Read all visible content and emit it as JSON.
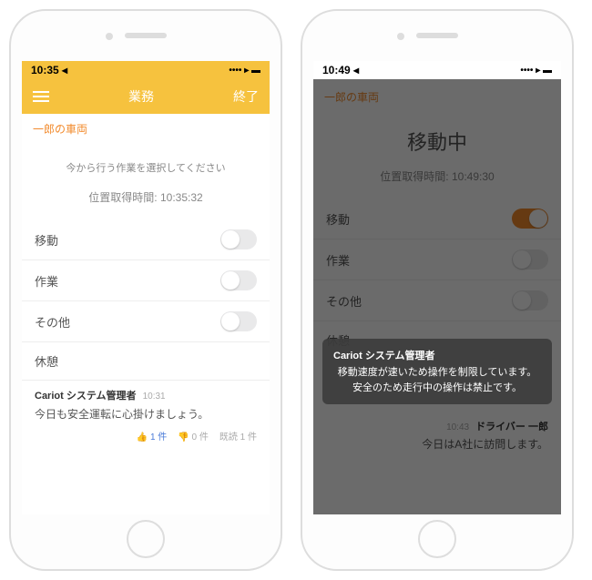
{
  "left": {
    "status_time": "10:35",
    "nav_title": "業務",
    "nav_finish": "終了",
    "crumb": "一郎の車両",
    "instruction": "今から行う作業を選択してください",
    "time_label": "位置取得時間: 10:35:32",
    "rows": {
      "move": "移動",
      "work": "作業",
      "other": "その他",
      "rest": "休憩"
    },
    "message": {
      "sender": "Cariot システム管理者",
      "time": "10:31",
      "body": "今日も安全運転に心掛けましょう。",
      "like_count": "1 件",
      "dislike_count": "0 件",
      "read_label": "既読",
      "read_count": "1 件"
    }
  },
  "right": {
    "status_time": "10:49",
    "crumb": "一郎の車両",
    "title": "移動中",
    "time_label": "位置取得時間: 10:49:30",
    "rows": {
      "move": "移動",
      "work": "作業",
      "other": "その他",
      "rest": "休憩"
    },
    "toast": {
      "from": "Cariot システム管理者",
      "body": "移動速度が速いため操作を制限しています。安全のため走行中の操作は禁止です。"
    },
    "msg_right": {
      "time": "10:43",
      "sender": "ドライバー 一郎",
      "body": "今日はA社に訪問します。"
    }
  }
}
